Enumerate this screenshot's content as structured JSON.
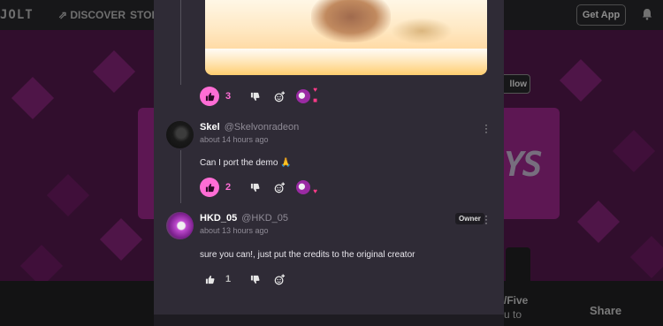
{
  "topbar": {
    "logo": "JOLT",
    "nav": [
      "DISCOVER",
      "STOR"
    ],
    "get_app": "Get App"
  },
  "banner": {
    "follow_label": "llow",
    "title_fragment": "YS"
  },
  "bottom": {
    "five": "/Five",
    "to": "u to",
    "share": "Share"
  },
  "thread": {
    "post_likes": "3",
    "comments": [
      {
        "username": "Skel",
        "handle": "@Skelvonradeon",
        "time": "about 14 hours ago",
        "text": "Can I port the demo 🙏",
        "likes": "2",
        "owner": ""
      },
      {
        "username": "HKD_05",
        "handle": "@HKD_05",
        "time": "about 13 hours ago",
        "text": "sure you can!, just put the credits to the original creator",
        "likes": "1",
        "owner": "Owner"
      }
    ]
  },
  "colors": {
    "accent": "#ff6dd5",
    "modal_bg": "#2f2b36",
    "banner": "#5a1a52"
  },
  "icons": [
    "thumbs-up-icon",
    "thumbs-down-icon",
    "add-reaction-icon",
    "more-icon",
    "bell-icon",
    "rocket-icon"
  ]
}
